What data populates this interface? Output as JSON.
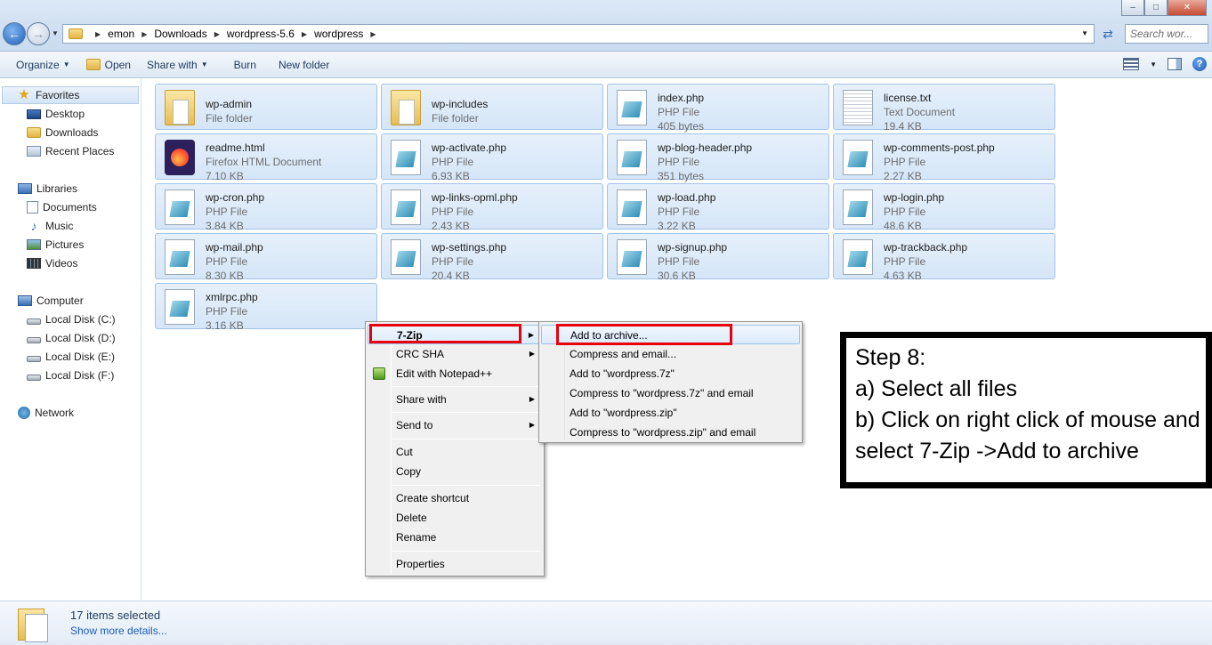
{
  "window": {
    "minimize": "‒",
    "maximize": "□",
    "close": "✕"
  },
  "address": {
    "crumbs": [
      "emon",
      "Downloads",
      "wordpress-5.6",
      "wordpress"
    ],
    "search_placeholder": "Search wor..."
  },
  "toolbar": {
    "organize": "Organize",
    "open": "Open",
    "share_with": "Share with",
    "burn": "Burn",
    "new_folder": "New folder"
  },
  "nav": {
    "favorites": "Favorites",
    "desktop": "Desktop",
    "downloads": "Downloads",
    "recent_places": "Recent Places",
    "libraries": "Libraries",
    "documents": "Documents",
    "music": "Music",
    "pictures": "Pictures",
    "videos": "Videos",
    "computer": "Computer",
    "disk_c": "Local Disk (C:)",
    "disk_d": "Local Disk (D:)",
    "disk_e": "Local Disk (E:)",
    "disk_f": "Local Disk (F:)",
    "network": "Network"
  },
  "files": [
    {
      "name": "wp-admin",
      "type": "File folder",
      "size": "",
      "icon": "folder-icon"
    },
    {
      "name": "wp-includes",
      "type": "File folder",
      "size": "",
      "icon": "folder-icon"
    },
    {
      "name": "index.php",
      "type": "PHP File",
      "size": "405 bytes",
      "icon": "php-file-icon"
    },
    {
      "name": "license.txt",
      "type": "Text Document",
      "size": "19.4 KB",
      "icon": "text-file-icon"
    },
    {
      "name": "readme.html",
      "type": "Firefox HTML Document",
      "size": "7.10 KB",
      "icon": "firefox-html-icon"
    },
    {
      "name": "wp-activate.php",
      "type": "PHP File",
      "size": "6.93 KB",
      "icon": "php-file-icon"
    },
    {
      "name": "wp-blog-header.php",
      "type": "PHP File",
      "size": "351 bytes",
      "icon": "php-file-icon"
    },
    {
      "name": "wp-comments-post.php",
      "type": "PHP File",
      "size": "2.27 KB",
      "icon": "php-file-icon"
    },
    {
      "name": "wp-cron.php",
      "type": "PHP File",
      "size": "3.84 KB",
      "icon": "php-file-icon"
    },
    {
      "name": "wp-links-opml.php",
      "type": "PHP File",
      "size": "2.43 KB",
      "icon": "php-file-icon"
    },
    {
      "name": "wp-load.php",
      "type": "PHP File",
      "size": "3.22 KB",
      "icon": "php-file-icon"
    },
    {
      "name": "wp-login.php",
      "type": "PHP File",
      "size": "48.6 KB",
      "icon": "php-file-icon"
    },
    {
      "name": "wp-mail.php",
      "type": "PHP File",
      "size": "8.30 KB",
      "icon": "php-file-icon"
    },
    {
      "name": "wp-settings.php",
      "type": "PHP File",
      "size": "20.4 KB",
      "icon": "php-file-icon"
    },
    {
      "name": "wp-signup.php",
      "type": "PHP File",
      "size": "30.6 KB",
      "icon": "php-file-icon"
    },
    {
      "name": "wp-trackback.php",
      "type": "PHP File",
      "size": "4.63 KB",
      "icon": "php-file-icon"
    },
    {
      "name": "xmlrpc.php",
      "type": "PHP File",
      "size": "3.16 KB",
      "icon": "php-file-icon"
    }
  ],
  "context_menu": {
    "seven_zip": "7-Zip",
    "crc_sha": "CRC SHA",
    "edit_notepad": "Edit with Notepad++",
    "share_with": "Share with",
    "send_to": "Send to",
    "cut": "Cut",
    "copy": "Copy",
    "create_shortcut": "Create shortcut",
    "delete": "Delete",
    "rename": "Rename",
    "properties": "Properties"
  },
  "submenu": {
    "add_to_archive": "Add to archive...",
    "compress_email": "Compress and email...",
    "add_7z": "Add to \"wordpress.7z\"",
    "compress_7z_email": "Compress to \"wordpress.7z\" and email",
    "add_zip": "Add to \"wordpress.zip\"",
    "compress_zip_email": "Compress to \"wordpress.zip\" and email"
  },
  "note": {
    "line1": "Step 8:",
    "line2": "a) Select all files",
    "line3": "b) Click on right click of mouse and",
    "line4": "select 7-Zip ->Add to archive"
  },
  "details": {
    "selected": "17 items selected",
    "show_more": "Show more details..."
  },
  "colors": {
    "highlight_box": "#e8000b",
    "selection": "#d5e6f8"
  }
}
